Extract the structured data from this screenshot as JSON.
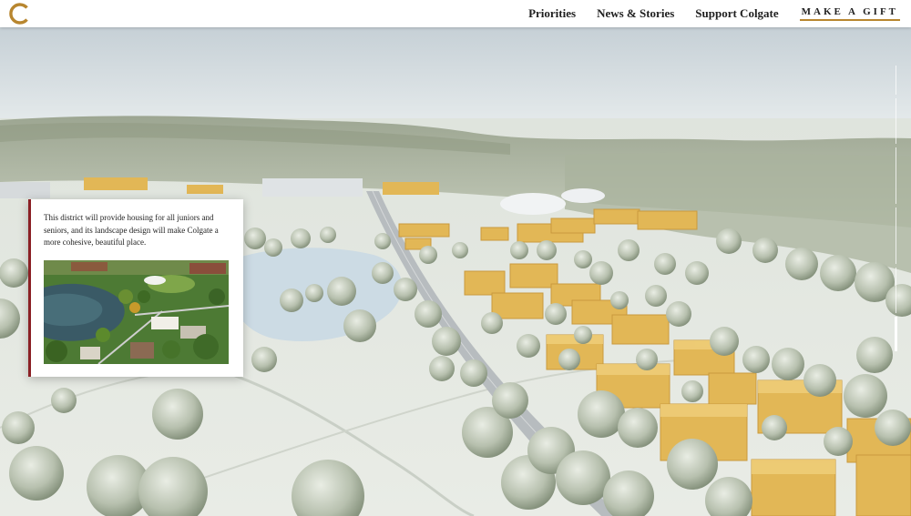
{
  "nav": {
    "logo_letter": "C",
    "links": [
      "Priorities",
      "News & Stories",
      "Support Colgate"
    ],
    "cta": "MAKE A GIFT"
  },
  "card": {
    "body": "This district will provide housing for all juniors and seniors, and its landscape design will make Colgate a more cohesive, beautiful place."
  },
  "progress": {
    "sections": 6,
    "active_index": 5
  },
  "colors": {
    "brand_maroon": "#8a1f24",
    "gold_accent": "#b8862f",
    "building_gold": "#e2b756"
  }
}
